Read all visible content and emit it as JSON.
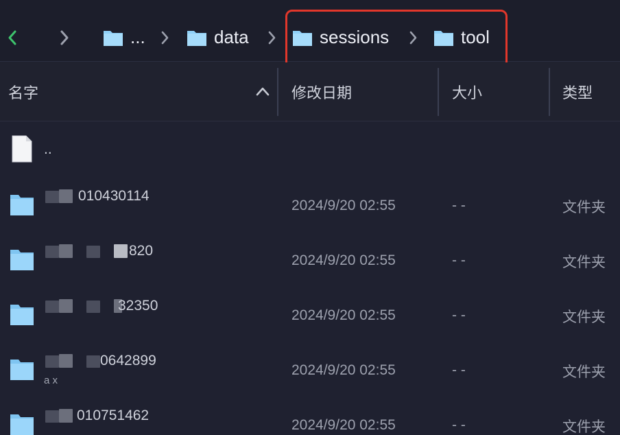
{
  "breadcrumb": {
    "items": [
      {
        "label": "..."
      },
      {
        "label": "data"
      },
      {
        "label": "sessions"
      },
      {
        "label": "tool"
      }
    ]
  },
  "columns": {
    "name": "名字",
    "modified": "修改日期",
    "size": "大小",
    "kind": "类型"
  },
  "rows": [
    {
      "name": "..",
      "date": "",
      "size": "",
      "kind": ""
    },
    {
      "name": "010430114",
      "date": "2024/9/20 02:55",
      "size": "- -",
      "kind": "文件夹"
    },
    {
      "name": "820",
      "date": "2024/9/20 02:55",
      "size": "- -",
      "kind": "文件夹"
    },
    {
      "name": "32350",
      "date": "2024/9/20 02:55",
      "size": "- -",
      "kind": "文件夹"
    },
    {
      "name": "0642899",
      "sub": "a         x",
      "date": "2024/9/20 02:55",
      "size": "- -",
      "kind": "文件夹"
    },
    {
      "name": "010751462",
      "date": "2024/9/20 02:55",
      "size": "- -",
      "kind": "文件夹"
    }
  ],
  "colors": {
    "background": "#1f2130",
    "folder": "#8fd0f7",
    "accent_green": "#3ec46d",
    "highlight": "#e2372b"
  }
}
